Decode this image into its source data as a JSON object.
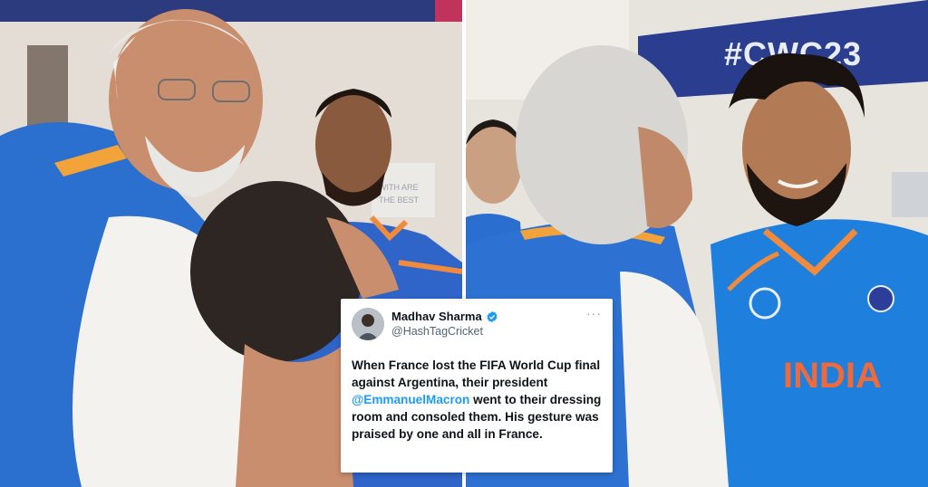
{
  "photos": {
    "right_banner_text": "#CWC23",
    "jersey_text": "INDIA",
    "wall_sign_lines": [
      "WITH ARE",
      "THE BEST"
    ]
  },
  "tweet": {
    "display_name": "Madhav Sharma",
    "handle": "@HashTagCricket",
    "more_glyph": "···",
    "verified_icon": "verified-badge-icon",
    "text_before_mention": "When France lost the FIFA World Cup final against Argentina, their president ",
    "mention": "@EmmanuelMacron",
    "text_after_mention": " went to their dressing room and consoled them. His gesture was praised by one and all in France.",
    "colors": {
      "mention": "#1d9bf0",
      "verified": "#1d9bf0"
    }
  }
}
